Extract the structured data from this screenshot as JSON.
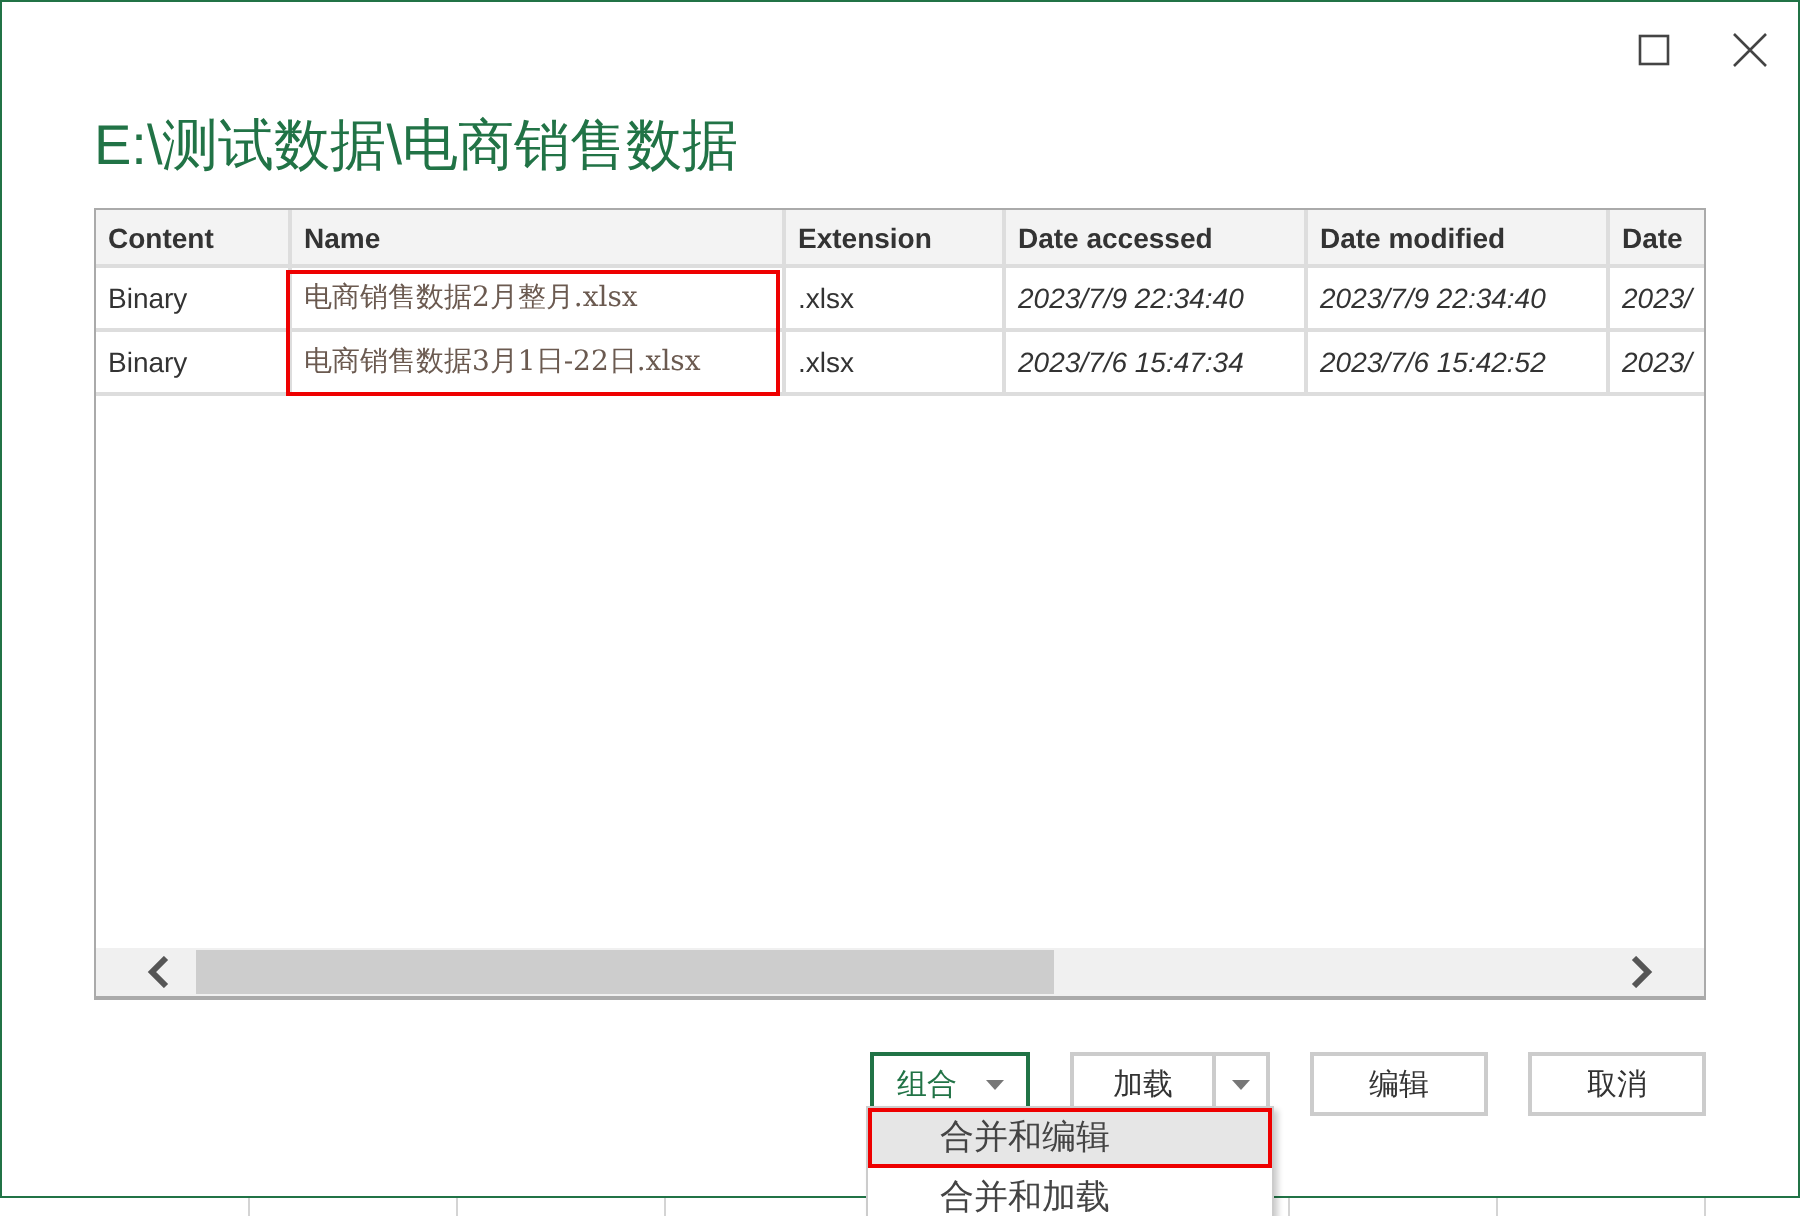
{
  "title": "E:\\测试数据\\电商销售数据",
  "table": {
    "columns": [
      "Content",
      "Name",
      "Extension",
      "Date accessed",
      "Date modified",
      "Date"
    ],
    "rows": [
      [
        "Binary",
        "电商销售数据2月整月.xlsx",
        ".xlsx",
        "2023/7/9 22:34:40",
        "2023/7/9 22:34:40",
        "2023/"
      ],
      [
        "Binary",
        "电商销售数据3月1日-22日.xlsx",
        ".xlsx",
        "2023/7/6 15:47:34",
        "2023/7/6 15:42:52",
        "2023/"
      ]
    ],
    "name_column_marked": true
  },
  "buttons": [
    {
      "label": "组合",
      "kind": "menu",
      "focused": true
    },
    {
      "label": "加载",
      "kind": "split",
      "focused": false
    },
    {
      "label": "编辑",
      "kind": "plain",
      "focused": false
    },
    {
      "label": "取消",
      "kind": "plain",
      "focused": false
    }
  ],
  "menu": {
    "items": [
      {
        "label": "合并和编辑",
        "selected": true,
        "marked": true
      },
      {
        "label": "合并和加载",
        "selected": false,
        "marked": false
      }
    ]
  }
}
